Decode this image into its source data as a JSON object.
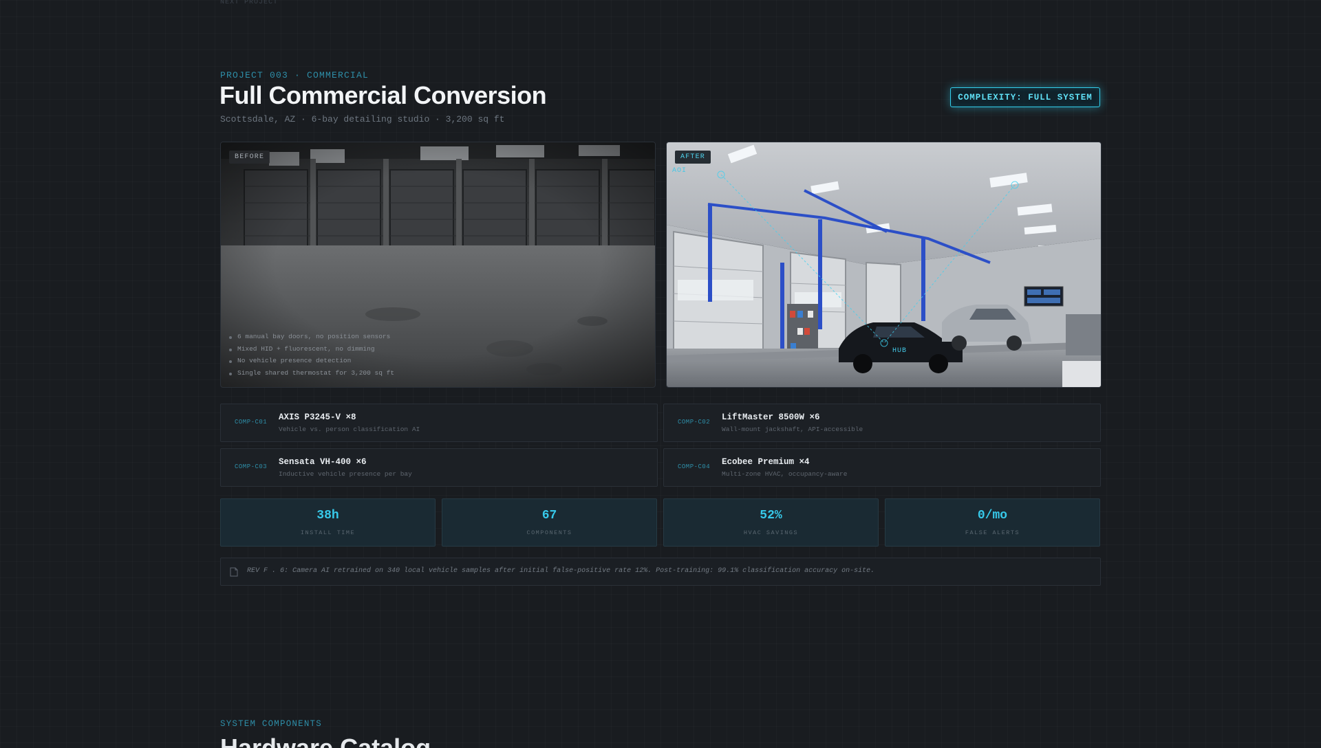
{
  "nav": {
    "prev_label": "NEXT PROJECT"
  },
  "project": {
    "eyebrow": "PROJECT 003 · COMMERCIAL",
    "title": "Full Commercial Conversion",
    "subtitle": "Scottsdale, AZ · 6-bay detailing studio · 3,200 sq ft",
    "complexity": "COMPLEXITY: FULL SYSTEM"
  },
  "before": {
    "tag": "BEFORE",
    "notes": [
      "6 manual bay doors, no position sensors",
      "Mixed HID + fluorescent, no dimming",
      "No vehicle presence detection",
      "Single shared thermostat for 3,200 sq ft"
    ]
  },
  "after": {
    "tag": "AFTER",
    "overlay_ai": "AOI",
    "overlay_hub": "HUB"
  },
  "components": [
    {
      "id": "COMP-C01",
      "name": "AXIS P3245-V ×8",
      "desc": "Vehicle vs. person classification AI"
    },
    {
      "id": "COMP-C02",
      "name": "LiftMaster 8500W ×6",
      "desc": "Wall-mount jackshaft, API-accessible"
    },
    {
      "id": "COMP-C03",
      "name": "Sensata VH-400 ×6",
      "desc": "Inductive vehicle presence per bay"
    },
    {
      "id": "COMP-C04",
      "name": "Ecobee Premium ×4",
      "desc": "Multi-zone HVAC, occupancy-aware"
    }
  ],
  "stats": [
    {
      "value": "38h",
      "label": "INSTALL TIME"
    },
    {
      "value": "67",
      "label": "COMPONENTS"
    },
    {
      "value": "52%",
      "label": "HVAC SAVINGS"
    },
    {
      "value": "0/mo",
      "label": "FALSE ALERTS"
    }
  ],
  "revision_note": "REV F . 6: Camera AI retrained on 340 local vehicle samples after initial false-positive rate 12%. Post-training: 99.1% classification accuracy on-site.",
  "next_section": {
    "label": "SYSTEM COMPONENTS",
    "title": "Hardware Catalog"
  },
  "colors": {
    "background": "#191c20",
    "accent": "#37c9ea",
    "eyebrow": "#2e8ea8"
  }
}
